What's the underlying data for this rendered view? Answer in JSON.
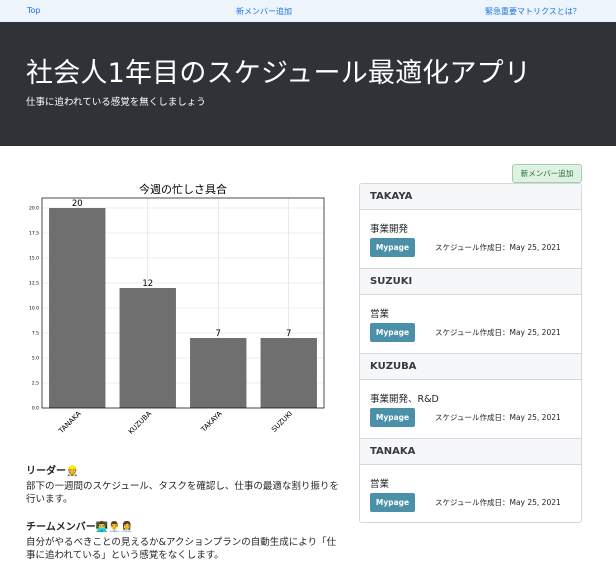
{
  "nav": {
    "top": "Top",
    "add_member": "新メンバー追加",
    "matrix": "緊急重要マトリクスとは？"
  },
  "hero": {
    "title": "社会人1年目のスケジュール最適化アプリ",
    "subtitle": "仕事に追われている感覚を無くしましょう"
  },
  "chart_data": {
    "type": "bar",
    "title": "今週の忙しさ具合",
    "categories": [
      "TANAKA",
      "KUZUBA",
      "TAKAYA",
      "SUZUKI"
    ],
    "values": [
      20,
      12,
      7,
      7
    ],
    "yticks": [
      "0.0",
      "2.5",
      "5.0",
      "7.5",
      "10.0",
      "12.5",
      "15.0",
      "17.5",
      "20.0"
    ],
    "ylim": [
      0,
      21
    ],
    "bar_color": "#6f6f6f",
    "grid": true
  },
  "leader": {
    "heading": "リーダー",
    "emoji": "👷",
    "text": "部下の一週間のスケジュール、タスクを確認し、仕事の最適な割り振りを行います。"
  },
  "team": {
    "heading": "チームメンバー",
    "emoji": "👨‍💻👨‍💼👩‍💼",
    "text": "自分がやるべきことの見えるか&アクションプランの自動生成により「仕事に追われている」という感覚をなくします。"
  },
  "add_member_button": "新メンバー追加",
  "members": [
    {
      "name": "TAKAYA",
      "dept": "事業開発",
      "button": "Mypage",
      "created": "スケジュール作成日：May 25, 2021"
    },
    {
      "name": "SUZUKI",
      "dept": "営業",
      "button": "Mypage",
      "created": "スケジュール作成日：May 25, 2021"
    },
    {
      "name": "KUZUBA",
      "dept": "事業開発、R&D",
      "button": "Mypage",
      "created": "スケジュール作成日：May 25, 2021"
    },
    {
      "name": "TANAKA",
      "dept": "営業",
      "button": "Mypage",
      "created": "スケジュール作成日：May 25, 2021"
    }
  ]
}
